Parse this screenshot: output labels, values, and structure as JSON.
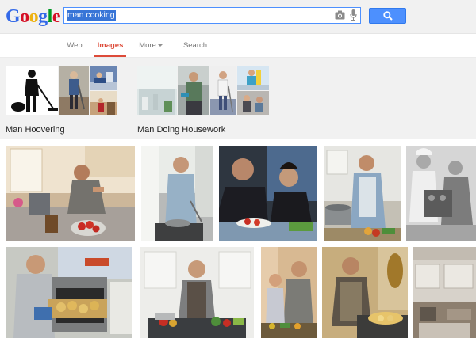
{
  "logo": {
    "letters": [
      "G",
      "o",
      "o",
      "g",
      "l",
      "e"
    ],
    "colors": [
      "#3369e8",
      "#d50f25",
      "#eeb211",
      "#3369e8",
      "#009925",
      "#d50f25"
    ]
  },
  "search": {
    "query": "man cooking",
    "button_icon": "search-icon",
    "accent": "#4d90fe"
  },
  "tabs": [
    {
      "label": "Web",
      "active": false
    },
    {
      "label": "Images",
      "active": true
    },
    {
      "label": "More",
      "active": false
    },
    {
      "label": "Search tools",
      "active": false
    }
  ],
  "suggestions": [
    {
      "label": "Man Hoovering"
    },
    {
      "label": "Man Doing Housework"
    }
  ]
}
